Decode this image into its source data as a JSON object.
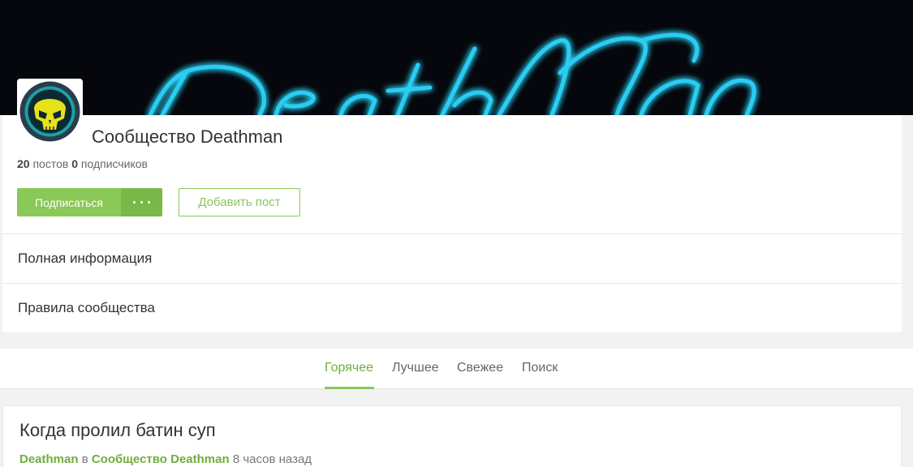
{
  "banner": {
    "text": "DeathMan",
    "neon_color": "#2fd8ff"
  },
  "community": {
    "title": "Сообщество Deathman",
    "posts_count": "20",
    "posts_label": "постов",
    "subscribers_count": "0",
    "subscribers_label": "подписчиков",
    "subscribe_label": "Подписаться",
    "add_post_label": "Добавить пост",
    "avatar_icon": "skull-logo-icon"
  },
  "info_rows": [
    {
      "label": "Полная информация"
    },
    {
      "label": "Правила сообщества"
    }
  ],
  "tabs": [
    {
      "label": "Горячее",
      "active": true
    },
    {
      "label": "Лучшее",
      "active": false
    },
    {
      "label": "Свежее",
      "active": false
    },
    {
      "label": "Поиск",
      "active": false
    }
  ],
  "post": {
    "title": "Когда пролил батин суп",
    "author": "Deathman",
    "in_label": "в",
    "community": "Сообщество Deathman",
    "time": "8 часов назад"
  },
  "colors": {
    "accent": "#8ac858",
    "link": "#6fae3d",
    "background": "#f2f2f2"
  }
}
